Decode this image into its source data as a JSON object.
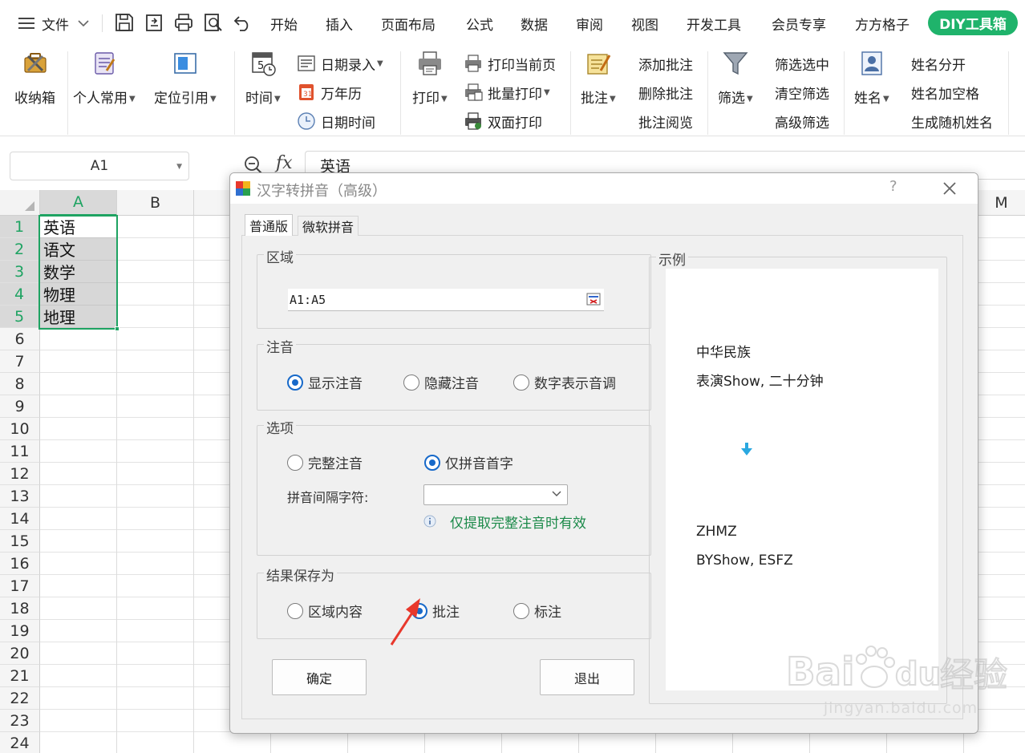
{
  "menu": {
    "file_label": "文件",
    "tabs": [
      "开始",
      "插入",
      "页面布局",
      "公式",
      "数据",
      "审阅",
      "视图",
      "开发工具",
      "会员专享",
      "方方格子"
    ],
    "diy_label": "DIY工具箱"
  },
  "ribbon": {
    "collect": "收纳箱",
    "personal": "个人常用",
    "locate": "定位引用",
    "time": "时间",
    "date_entry": "日期录入",
    "calendar": "万年历",
    "datetime": "日期时间",
    "print": "打印",
    "print_current": "打印当前页",
    "batch_print": "批量打印",
    "duplex_print": "双面打印",
    "comment": "批注",
    "add_comment": "添加批注",
    "delete_comment": "删除批注",
    "view_comment": "批注阅览",
    "filter": "筛选",
    "filter_selected": "筛选选中",
    "clear_filter": "清空筛选",
    "advanced_filter": "高级筛选",
    "name": "姓名",
    "split_name": "姓名分开",
    "name_space": "姓名加空格",
    "random_name": "生成随机姓名"
  },
  "formula_bar": {
    "name_box": "A1",
    "fx": "fx",
    "content": "英语"
  },
  "sheet": {
    "columns": [
      "A",
      "B",
      "M"
    ],
    "rows": [
      "1",
      "2",
      "3",
      "4",
      "5",
      "6",
      "7",
      "8",
      "9",
      "10",
      "11",
      "12",
      "13",
      "14",
      "15",
      "16",
      "17",
      "18",
      "19",
      "20",
      "21",
      "22",
      "23",
      "24"
    ],
    "cells": [
      "英语",
      "语文",
      "数学",
      "物理",
      "地理"
    ]
  },
  "dialog": {
    "title": "汉字转拼音（高级）",
    "help": "?",
    "tabs": [
      "普通版",
      "微软拼音"
    ],
    "region": {
      "legend": "区域",
      "value": "A1:A5"
    },
    "annotation": {
      "legend": "注音",
      "options": [
        "显示注音",
        "隐藏注音",
        "数字表示音调"
      ],
      "selected": "显示注音"
    },
    "options": {
      "legend": "选项",
      "choices": [
        "完整注音",
        "仅拼音首字"
      ],
      "selected": "仅拼音首字",
      "separator_label": "拼音间隔字符:",
      "separator_value": "",
      "info": "仅提取完整注音时有效"
    },
    "save_as": {
      "legend": "结果保存为",
      "options": [
        "区域内容",
        "批注",
        "标注"
      ],
      "selected": "批注"
    },
    "buttons": {
      "ok": "确定",
      "exit": "退出"
    },
    "example": {
      "legend": "示例",
      "before": [
        "中华民族",
        "表演Show, 二十分钟"
      ],
      "after": [
        "ZHMZ",
        "BYShow, ESFZ"
      ]
    }
  },
  "colors": {
    "accent_green": "#1fb36b",
    "selection_green": "#1ea362",
    "radio_blue": "#1769c9",
    "pointer_red": "#e8382c",
    "info_green": "#1c8a4a"
  },
  "watermark": {
    "text": "jingyan.baidu.com"
  }
}
